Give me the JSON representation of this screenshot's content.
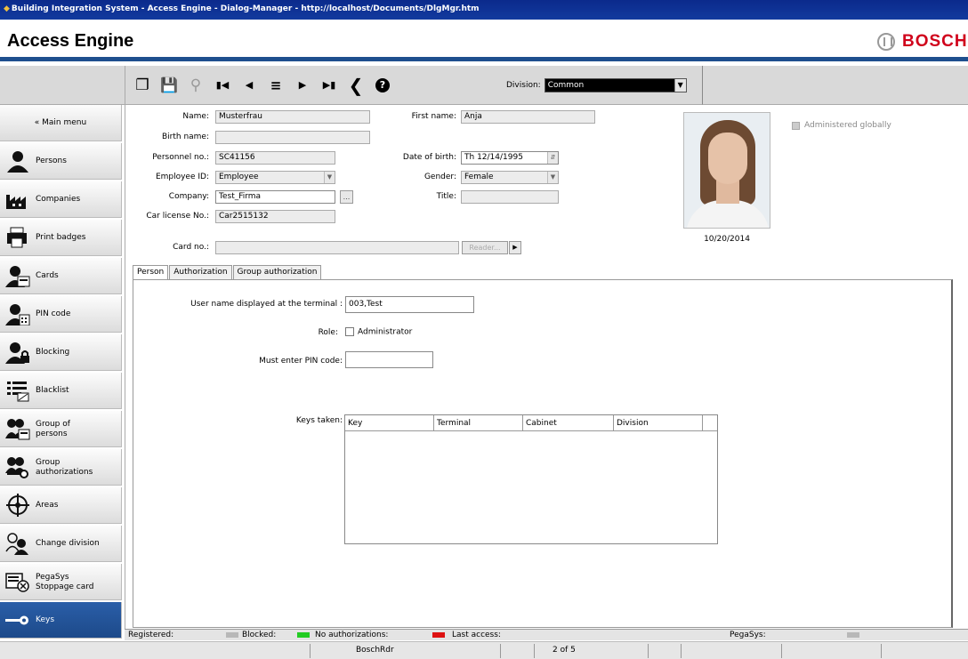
{
  "window": {
    "title": "Building Integration System - Access Engine - Dialog-Manager - http://localhost/Documents/DlgMgr.htm"
  },
  "header": {
    "app_title": "Access Engine",
    "brand": "BOSCH"
  },
  "toolbar": {
    "division_label": "Division:",
    "division_value": "Common"
  },
  "sidebar": {
    "main_menu": "« Main menu",
    "items": [
      {
        "label": "Persons"
      },
      {
        "label": "Companies"
      },
      {
        "label": "Print badges"
      },
      {
        "label": "Cards"
      },
      {
        "label": "PIN code"
      },
      {
        "label": "Blocking"
      },
      {
        "label": "Blacklist"
      },
      {
        "label": "Group of\npersons"
      },
      {
        "label": "Group\nauthorizations"
      },
      {
        "label": "Areas"
      },
      {
        "label": "Change division"
      },
      {
        "label": "PegaSys\nStoppage card"
      },
      {
        "label": "Keys"
      }
    ]
  },
  "person": {
    "name_label": "Name:",
    "name": "Musterfrau",
    "first_name_label": "First name:",
    "first_name": "Anja",
    "birth_name_label": "Birth name:",
    "birth_name": "",
    "personnel_label": "Personnel no.:",
    "personnel": "SC41156",
    "dob_label": "Date of birth:",
    "dob": "Th 12/14/1995",
    "employee_id_label": "Employee ID:",
    "employee_id": "Employee",
    "gender_label": "Gender:",
    "gender": "Female",
    "company_label": "Company:",
    "company": "Test_Firma",
    "company_btn": "...",
    "title_label": "Title:",
    "title": "",
    "car_label": "Car license No.:",
    "car": "Car2515132",
    "card_label": "Card no.:",
    "card": "",
    "reader_btn": "Reader...",
    "photo_date": "10/20/2014",
    "admin_globally": "Administered globally"
  },
  "tabs": [
    {
      "label": "Person"
    },
    {
      "label": "Authorization"
    },
    {
      "label": "Group authorization"
    }
  ],
  "panel": {
    "username_label": "User name displayed at the terminal :",
    "username": "003,Test",
    "role_label": "Role:",
    "role_option": "Administrator",
    "pin_label": "Must enter PIN code:",
    "pin": "",
    "keys_label": "Keys taken:",
    "keys_columns": [
      "Key",
      "Terminal",
      "Cabinet",
      "Division"
    ]
  },
  "status": {
    "registered": "Registered:",
    "blocked": "Blocked:",
    "no_auth": "No authorizations:",
    "last_access": "Last access:",
    "pegasys": "PegaSys:",
    "colors": {
      "registered": "#b8b8b8",
      "blocked": "#22cc22",
      "no_auth": "#dd1111"
    }
  },
  "bottom": {
    "reader": "BoschRdr",
    "record": "2 of 5"
  }
}
